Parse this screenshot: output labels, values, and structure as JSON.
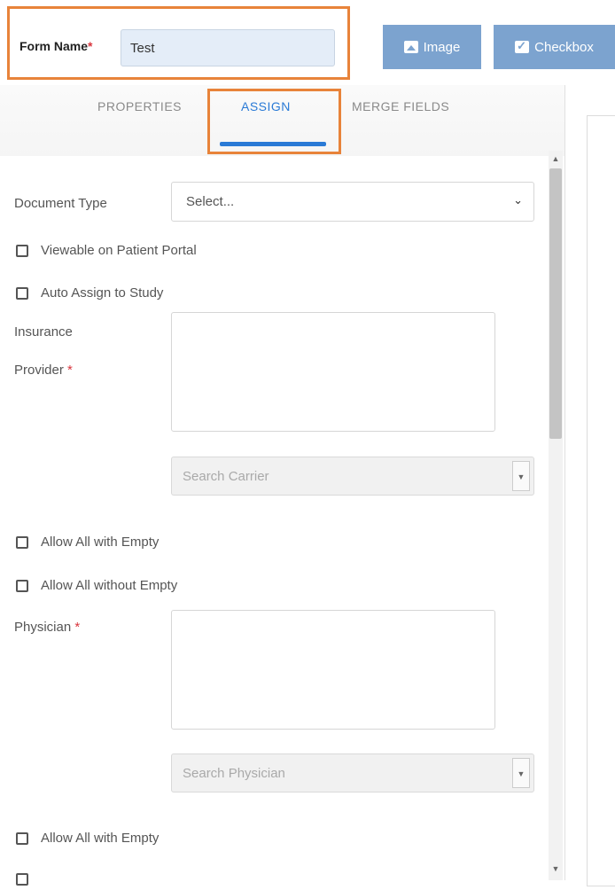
{
  "header": {
    "form_name_label": "Form Name",
    "form_name_required": "*",
    "form_name_value": "Test",
    "buttons": {
      "image": "Image",
      "checkbox": "Checkbox"
    }
  },
  "tabs": [
    "PROPERTIES",
    "ASSIGN",
    "MERGE FIELDS"
  ],
  "active_tab": "ASSIGN",
  "assign": {
    "document_type_label": "Document Type",
    "document_type_value": "Select...",
    "viewable_label": "Viewable on Patient Portal",
    "auto_assign_label": "Auto Assign to Study",
    "insurance_label_line1": "Insurance",
    "insurance_label_line2": "Provider",
    "required_mark": "*",
    "search_carrier_placeholder": "Search Carrier",
    "allow_empty_label": "Allow All with Empty",
    "allow_without_empty_label": "Allow All without Empty",
    "physician_label": "Physician",
    "search_physician_placeholder": "Search Physician",
    "allow_empty_label_2": "Allow All with Empty"
  },
  "colors": {
    "accent": "#2a7ad6",
    "highlight": "#e8833a",
    "toolbar_button": "#7ca3cf",
    "required": "#d9363e"
  }
}
